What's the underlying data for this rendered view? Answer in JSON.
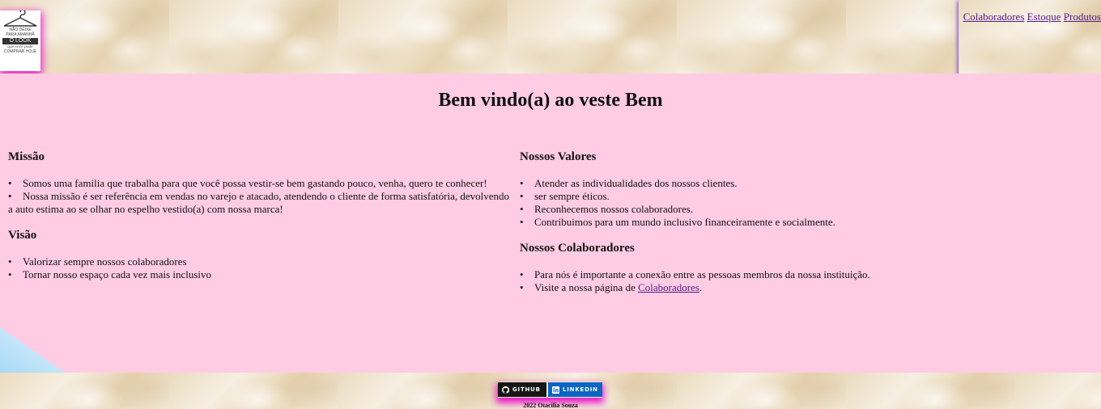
{
  "header": {
    "logo": {
      "line1": "NÃO DEIXE",
      "line2": "PARA AMANHÃ",
      "line3": "O LOOK",
      "line4": "que você pode",
      "line5": "COMPRAR HOJE"
    },
    "nav": [
      {
        "label": "Colaboradores"
      },
      {
        "label": "Estoque"
      },
      {
        "label": "Produtos"
      }
    ]
  },
  "main": {
    "title": "Bem vindo(a) ao veste Bem",
    "missao": {
      "heading": "Missão",
      "items": [
        "Somos uma familia que trabalha para que você possa vestir-se bem gastando pouco, venha, quero te conhecer!",
        "Nossa missão é ser referência em vendas no varejo e atacado, atendendo o cliente de forma satisfatória, devolvendo a auto estima ao se olhar no espelho vestido(a) com nossa marca!"
      ]
    },
    "visao": {
      "heading": "Visão",
      "items": [
        "Valorizar sempre nossos colaboradores",
        "Tornar nosso espaço cada vez mais inclusivo"
      ]
    },
    "valores": {
      "heading": "Nossos Valores",
      "items": [
        "Atender as individualidades dos nossos clientes.",
        "ser sempre éticos.",
        "Reconhecemos nossos colaboradores.",
        "Contribuimos para um mundo inclusivo financeiramente e socialmente."
      ]
    },
    "colaboradores": {
      "heading": "Nossos Colaboradores",
      "item1": "Para nós é importante a conexão entre as pessoas membros da nossa instituição.",
      "item2_prefix": "Visite a nossa página de ",
      "item2_link": "Colaboradores",
      "item2_suffix": "."
    }
  },
  "footer": {
    "github_label": "GITHUB",
    "linkedin_label": "LINKEDIN",
    "copyright": "2022 Otacilia Souza"
  },
  "colors": {
    "main_background": "#ffcce3",
    "glow": "#e81cc6",
    "nav_shadow": "#7a3cd1",
    "link": "#551a8b",
    "github": "#161616",
    "linkedin": "#0a66c2"
  }
}
